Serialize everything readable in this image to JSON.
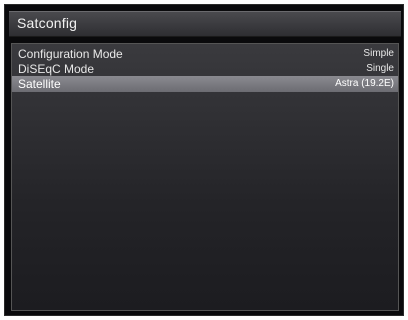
{
  "window": {
    "title": "Satconfig"
  },
  "config_list": {
    "rows": [
      {
        "label": "Configuration Mode",
        "value": "Simple",
        "selected": false
      },
      {
        "label": "DiSEqC Mode",
        "value": "Single",
        "selected": false
      },
      {
        "label": "Satellite",
        "value": "Astra (19.2E)",
        "selected": true
      }
    ]
  },
  "colors": {
    "background": "#0a0a0c",
    "title_bar": "#3a3a3e",
    "selection": "#7a7a80",
    "text": "#e8e8e8"
  }
}
